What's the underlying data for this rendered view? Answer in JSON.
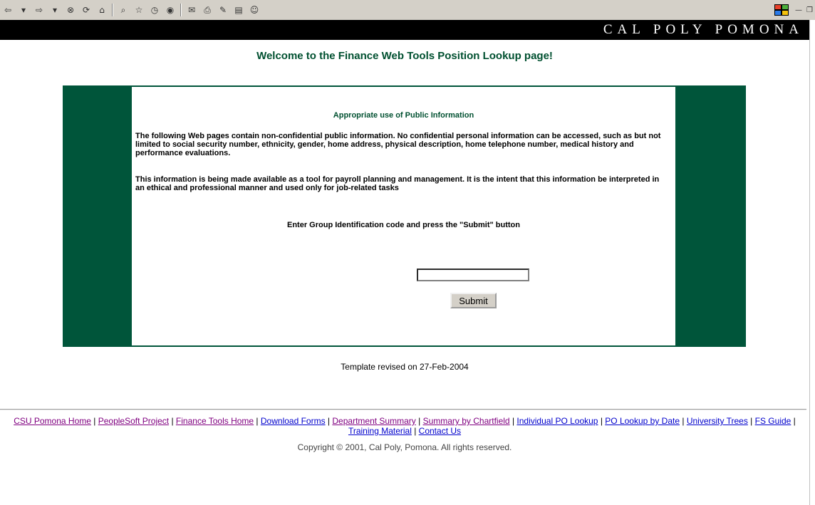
{
  "browser": {
    "toolbar_icons": [
      "back-icon",
      "dropdown-icon",
      "forward-icon",
      "dropdown-icon",
      "stop-icon",
      "refresh-icon",
      "home-icon",
      "search-icon",
      "favorites-icon",
      "history-icon",
      "media-icon",
      "mail-icon",
      "print-icon",
      "edit-icon",
      "discuss-icon",
      "messenger-icon"
    ]
  },
  "banner": {
    "title": "CAL POLY POMONA"
  },
  "welcome": "Welcome to the Finance Web Tools Position Lookup page!",
  "notice": {
    "title": "Appropriate use of Public Information",
    "para1": "The following Web pages contain non-confidential public information. No confidential personal information can be accessed, such as but not limited to social security number, ethnicity, gender, home address, physical description, home telephone number, medical history and performance evaluations.",
    "para2": "This information is being made available as a tool for payroll planning and management. It is the intent that this information be interpreted in an ethical and professional manner and used only for job-related tasks",
    "instruction": "Enter Group Identification code and press the \"Submit\" button"
  },
  "form": {
    "group_id_value": "",
    "submit_label": "Submit"
  },
  "revised": "Template revised on 27-Feb-2004",
  "footer": {
    "links": [
      "CSU Pomona Home",
      "PeopleSoft Project",
      "Finance Tools Home",
      "Download Forms",
      "Department Summary",
      "Summary by Chartfield",
      "Individual PO Lookup",
      "PO Lookup by Date",
      "University Trees",
      "FS Guide",
      "Training Material",
      "Contact Us"
    ],
    "separator": " | ",
    "copyright": "Copyright © 2001, Cal Poly, Pomona. All rights reserved."
  },
  "colors": {
    "brand_green": "#00553a",
    "heading_green": "#005030",
    "link_blue": "#0000cc",
    "link_visited": "#800080"
  }
}
